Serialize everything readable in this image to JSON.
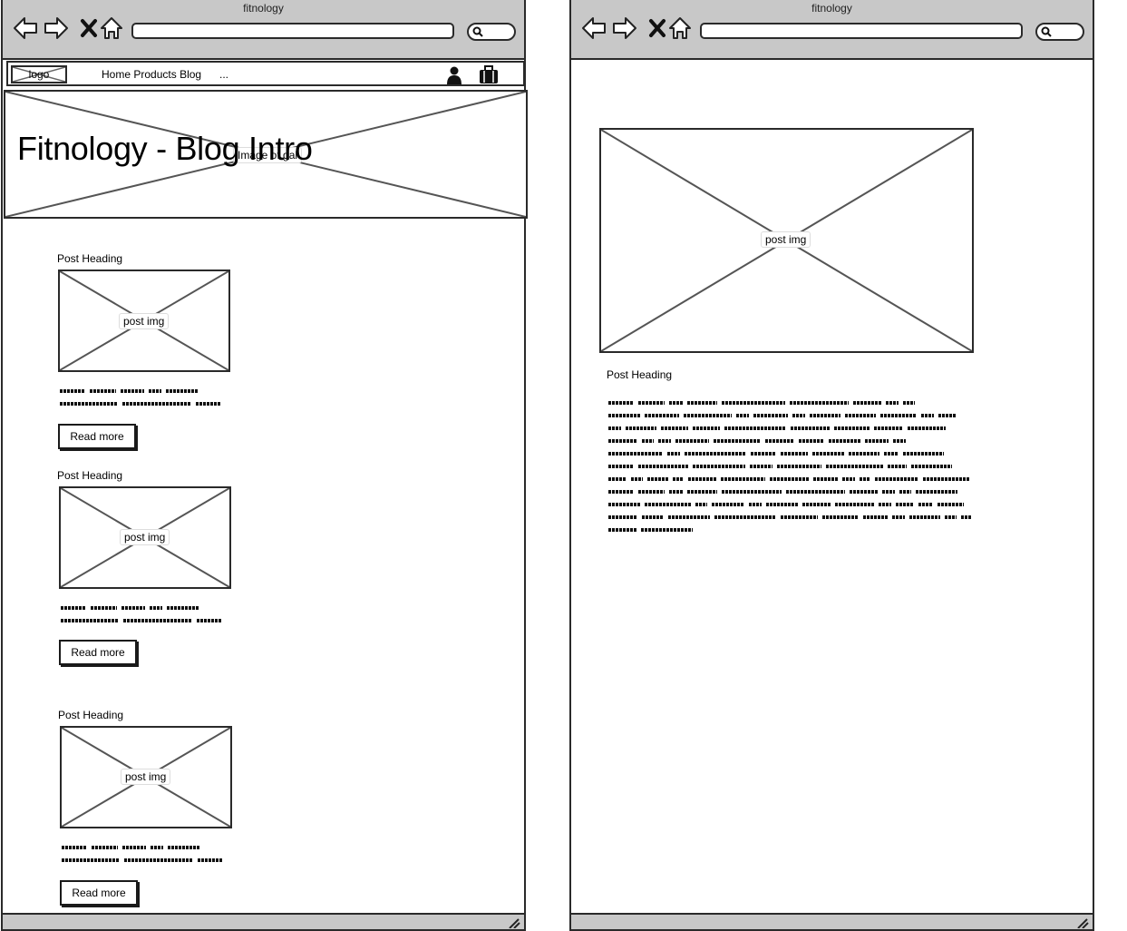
{
  "left_window": {
    "title": "fitnology",
    "nav": {
      "logo": "logo",
      "links": [
        "Home",
        "Products",
        "Blog"
      ],
      "more": "..."
    },
    "hero": {
      "title": "Fitnology - Blog Intro",
      "image_label": "Image of gal"
    },
    "posts": [
      {
        "heading": "Post Heading",
        "image_label": "post img",
        "button": "Read more"
      },
      {
        "heading": "Post Heading",
        "image_label": "post img",
        "button": "Read more"
      },
      {
        "heading": "Post Heading",
        "image_label": "post img",
        "button": "Read more"
      }
    ]
  },
  "right_window": {
    "title": "fitnology",
    "image_label": "post img",
    "post_heading": "Post Heading"
  },
  "icons": {
    "back": "back-arrow-icon",
    "forward": "forward-arrow-icon",
    "stop": "close-icon",
    "home": "home-icon",
    "search": "search-icon",
    "user": "user-icon",
    "cart": "briefcase-icon"
  }
}
